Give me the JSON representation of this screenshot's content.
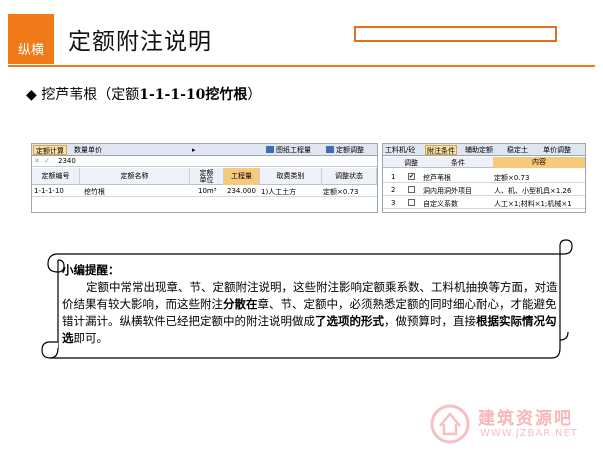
{
  "header": {
    "logo_text": "纵横",
    "title": "定额附注说明"
  },
  "heading": {
    "bullet": "◆",
    "main": "挖芦苇根（定额",
    "bold": "1-1-1-10挖竹根",
    "end": "）"
  },
  "app": {
    "left_tabs": [
      "定额计算",
      "数量单价"
    ],
    "marker": "▸",
    "toolbar": [
      "图纸工程量",
      "定额调整"
    ],
    "edit_value": "2340",
    "columns": [
      "定额编号",
      "定额名称",
      "定额\n单位",
      "工程量",
      "取费类别",
      "调整状态"
    ],
    "row": {
      "code": "1-1-1-10",
      "name": "挖竹根",
      "unit": "10m³",
      "qty": "234.000",
      "fee": "1)人工土方",
      "status": "定额×0.73"
    },
    "right_tabs": [
      "工料机/砼",
      "附注条件",
      "辅助定额",
      "稳定土",
      "单价调整"
    ],
    "right_columns": [
      "调整",
      "条件",
      "内容"
    ],
    "right_rows": [
      {
        "no": "1",
        "checked": "✔",
        "cond": "挖芦苇根",
        "content": "定额×0.73"
      },
      {
        "no": "2",
        "checked": "",
        "cond": "洞内用洞外项目",
        "content": "人、机、小型机具×1.26"
      },
      {
        "no": "3",
        "checked": "",
        "cond": "自定义系数",
        "content": "人工×1;材料×1;机械×1"
      }
    ]
  },
  "note": {
    "title": "小编提醒：",
    "p1": "定额中常常出现章、节、定额附注说明，这些附注影响定额乘系数、工料机抽换等方面，对造价结果有较大影响，而这些附注",
    "b1": "分散在",
    "p2": "章、节、定额中，必须熟悉定额的同时细心耐心，才能避免错计漏计。纵横软件已经把定额中的附注说明做成",
    "b2": "了选项的形式",
    "p3": "，做预算时，直接",
    "b3": "根据实际情况勾选",
    "p4": "即可。"
  },
  "watermark": {
    "text": "建筑资源吧",
    "url": "WWW.JZBAR.NET"
  },
  "colors": {
    "accent": "#f07a1a",
    "highlight": "#e2701f",
    "column_highlight": "#f7c97a"
  }
}
